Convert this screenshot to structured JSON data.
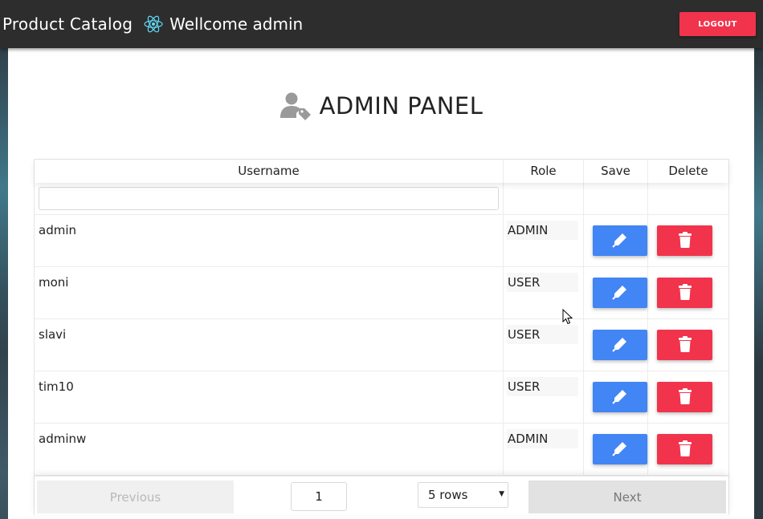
{
  "navbar": {
    "brand": "Product Catalog",
    "welcome": "Wellcome admin",
    "logout_label": "LOGOUT"
  },
  "panel": {
    "title": "ADMIN PANEL"
  },
  "table": {
    "columns": [
      "Username",
      "Role",
      "Save",
      "Delete"
    ],
    "filter_value": "",
    "rows": [
      {
        "username": "admin",
        "role": "ADMIN"
      },
      {
        "username": "moni",
        "role": "USER"
      },
      {
        "username": "slavi",
        "role": "USER"
      },
      {
        "username": "tim10",
        "role": "USER"
      },
      {
        "username": "adminw",
        "role": "ADMIN"
      }
    ]
  },
  "pagination": {
    "previous_label": "Previous",
    "page": "1",
    "rows_option": "5 rows",
    "next_label": "Next"
  },
  "colors": {
    "navbar_bg": "#2d2d2d",
    "danger": "#f2334c",
    "primary": "#4285f4"
  },
  "icons": {
    "brand": "react-icon",
    "title": "user-tag-icon",
    "save": "pencil-icon",
    "delete": "trash-icon"
  }
}
